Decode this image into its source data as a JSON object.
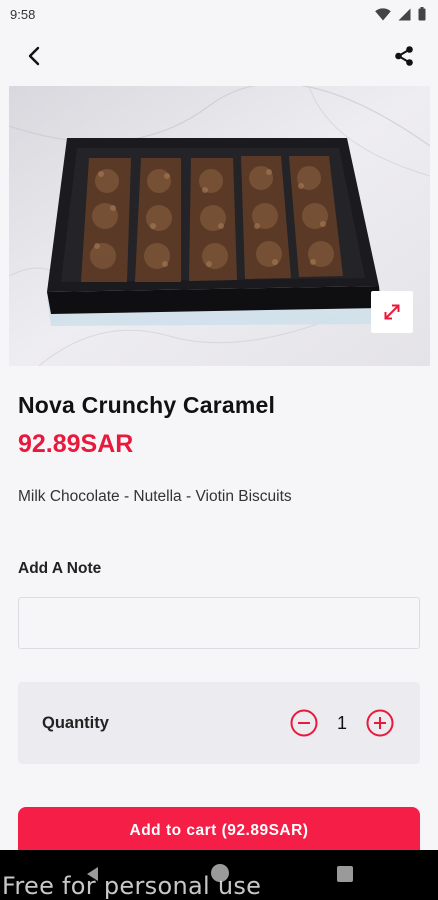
{
  "status_bar": {
    "time": "9:58"
  },
  "product": {
    "name": "Nova Crunchy Caramel",
    "price": "92.89SAR",
    "description": "Milk Chocolate - Nutella - Viotin Biscuits"
  },
  "note": {
    "label": "Add A Note",
    "value": "",
    "placeholder": ""
  },
  "quantity": {
    "label": "Quantity",
    "value": "1"
  },
  "cart": {
    "button_label": "Add to cart (92.89SAR)"
  },
  "watermark": "Free for personal use",
  "icons": {
    "back": "arrow-back-icon",
    "share": "share-icon",
    "expand": "expand-icon",
    "minus": "minus-circle-icon",
    "plus": "plus-circle-icon"
  },
  "colors": {
    "accent": "#e8193c",
    "button": "#f41e46",
    "background": "#f6f6f8"
  }
}
